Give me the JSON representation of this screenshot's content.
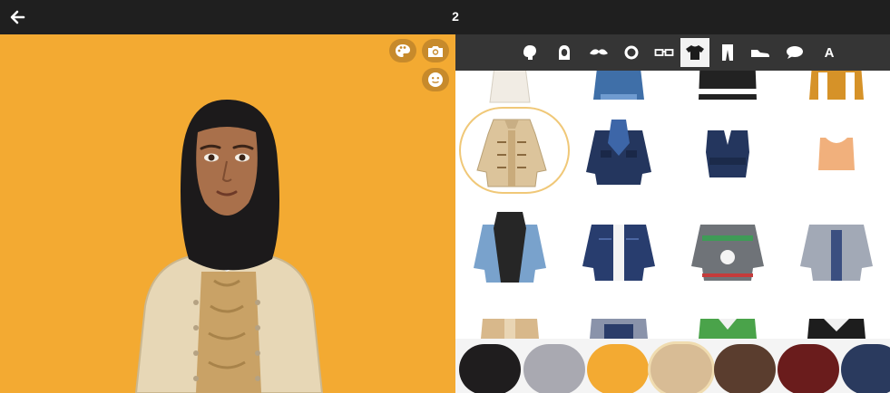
{
  "topbar": {
    "back_icon": "back-arrow-icon",
    "page_number": "2"
  },
  "stage": {
    "background": "#f3aa32",
    "buttons": [
      "palette-icon",
      "camera-icon",
      "emoji-icon"
    ]
  },
  "tabs": {
    "items": [
      "hair-icon",
      "head-icon",
      "mustache-icon",
      "eye-icon",
      "glasses-icon",
      "shirt-icon",
      "pants-icon",
      "shoe-icon",
      "speech-bubble-icon",
      "text-icon"
    ],
    "active": "shirt-icon",
    "text_tab_label": "A"
  },
  "outfits": {
    "items": [
      "trench-coat",
      "denim-jacket",
      "puffer-vest",
      "varsity-jacket",
      "duffle-coat",
      "navy-jacket-scarf",
      "wrap-top",
      "crop-tank",
      "hooded-denim-jacket",
      "navy-denim-jacket",
      "holiday-sweater",
      "grey-blazer",
      "utility-jacket",
      "overall-jacket",
      "green-polo",
      "black-polo"
    ],
    "selected": "duffle-coat"
  },
  "colors": {
    "swatches": [
      "#1f1d1e",
      "#a9a9b1",
      "#f3aa32",
      "#d8bc95",
      "#5a3d2e",
      "#6a1c1c",
      "#2a3a5e"
    ],
    "selected": "#d8bc95"
  }
}
